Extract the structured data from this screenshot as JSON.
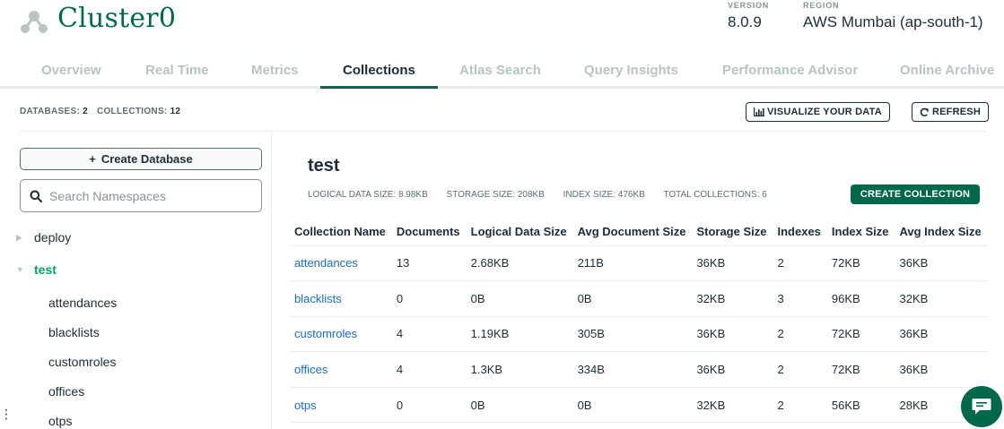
{
  "header": {
    "cluster_name": "Cluster0",
    "version_label": "VERSION",
    "version_value": "8.0.9",
    "region_label": "REGION",
    "region_value": "AWS Mumbai (ap-south-1)"
  },
  "tabs": [
    {
      "label": "Overview",
      "active": false
    },
    {
      "label": "Real Time",
      "active": false
    },
    {
      "label": "Metrics",
      "active": false
    },
    {
      "label": "Collections",
      "active": true
    },
    {
      "label": "Atlas Search",
      "active": false
    },
    {
      "label": "Query Insights",
      "active": false
    },
    {
      "label": "Performance Advisor",
      "active": false
    },
    {
      "label": "Online Archive",
      "active": false
    }
  ],
  "stats": {
    "databases_label": "DATABASES:",
    "databases_value": "2",
    "collections_label": "COLLECTIONS:",
    "collections_value": "12"
  },
  "toolbar": {
    "visualize_label": "VISUALIZE YOUR DATA",
    "refresh_label": "REFRESH"
  },
  "sidebar": {
    "create_db_label": "Create Database",
    "search_placeholder": "Search Namespaces",
    "databases": [
      {
        "name": "deploy",
        "expanded": false
      },
      {
        "name": "test",
        "expanded": true
      }
    ],
    "collections": [
      "attendances",
      "blacklists",
      "customroles",
      "offices",
      "otps"
    ]
  },
  "main": {
    "db_title": "test",
    "logical_size": "LOGICAL DATA SIZE: 8.98KB",
    "storage_size": "STORAGE SIZE: 208KB",
    "index_size": "INDEX SIZE: 476KB",
    "total_collections": "TOTAL COLLECTIONS: 6",
    "create_collection_label": "CREATE COLLECTION",
    "columns": [
      "Collection Name",
      "Documents",
      "Logical Data Size",
      "Avg Document Size",
      "Storage Size",
      "Indexes",
      "Index Size",
      "Avg Index Size"
    ],
    "rows": [
      [
        "attendances",
        "13",
        "2.68KB",
        "211B",
        "36KB",
        "2",
        "72KB",
        "36KB"
      ],
      [
        "blacklists",
        "0",
        "0B",
        "0B",
        "32KB",
        "3",
        "96KB",
        "32KB"
      ],
      [
        "customroles",
        "4",
        "1.19KB",
        "305B",
        "36KB",
        "2",
        "72KB",
        "36KB"
      ],
      [
        "offices",
        "4",
        "1.3KB",
        "334B",
        "36KB",
        "2",
        "72KB",
        "36KB"
      ],
      [
        "otps",
        "0",
        "0B",
        "0B",
        "32KB",
        "2",
        "56KB",
        "28KB"
      ]
    ]
  },
  "colors": {
    "brand_green": "#00684a",
    "active_db": "#00a35c",
    "link_blue": "#1a6bc4"
  }
}
